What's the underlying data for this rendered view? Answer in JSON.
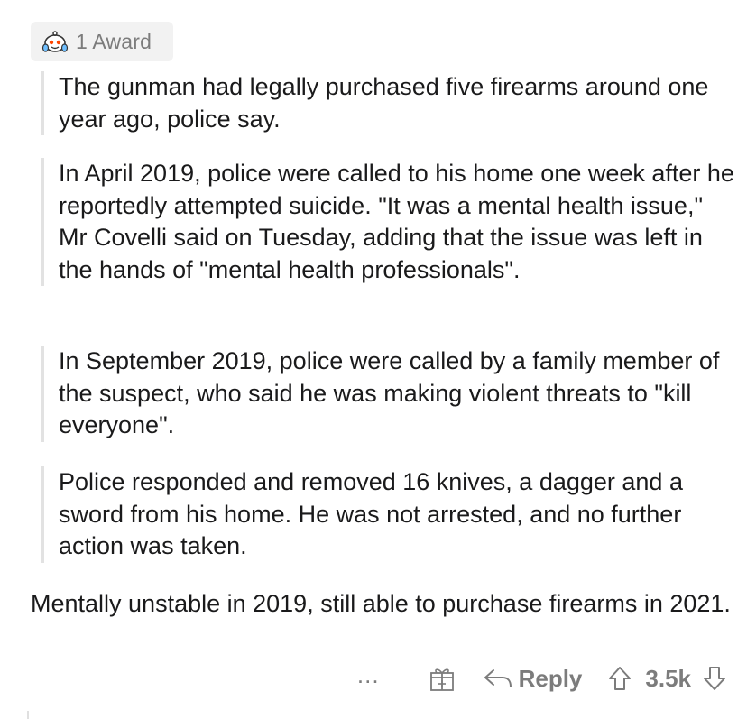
{
  "award": {
    "label": "1 Award",
    "icon": "wholesome-award-icon"
  },
  "quotes": [
    {
      "text": "The gunman had legally purchased five firearms around one year ago, police say."
    },
    {
      "text": "In April 2019, police were called to his home one week after he reportedly attempted suicide. \"It was a mental health issue,\" Mr Covelli said on Tuesday, adding that the issue was left in the hands of \"mental health professionals\"."
    },
    {
      "text": "In September 2019, police were called by a family member of the suspect, who said he was making violent threats to \"kill everyone\"."
    },
    {
      "text": "Police responded and removed 16 knives, a dagger and a sword from his home. He was not arrested, and no further action was taken."
    }
  ],
  "comment": {
    "text": "Mentally unstable in 2019, still able to purchase firearms in 2021."
  },
  "actions": {
    "more": "...",
    "gift_icon": "gift-icon",
    "reply_label": "Reply",
    "score": "3.5k"
  },
  "colors": {
    "text": "#1a1a1b",
    "muted": "#7c7c7c",
    "quote_bar": "#e2e2e2",
    "award_bg": "#f2f2f2"
  }
}
